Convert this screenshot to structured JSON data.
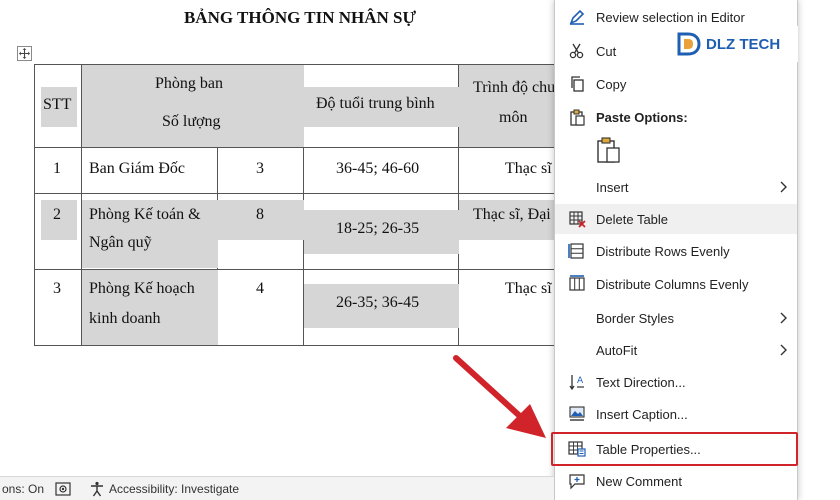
{
  "document": {
    "title": "BẢNG THÔNG TIN NHÂN SỰ",
    "table": {
      "headers": {
        "stt": "STT",
        "department": "Phòng ban",
        "quantity": "Số lượng",
        "age": "Độ tuổi trung bình",
        "education_line1": "Trình độ chu",
        "education_line2": "môn"
      },
      "rows": [
        {
          "stt": "1",
          "dept_line1": "Ban Giám Đốc",
          "dept_line2": "",
          "qty": "3",
          "age": "36-45; 46-60",
          "edu": "Thạc sĩ"
        },
        {
          "stt": "2",
          "dept_line1": "Phòng Kế toán &",
          "dept_line2": "Ngân quỹ",
          "qty": "8",
          "age": "18-25; 26-35",
          "edu": "Thạc sĩ, Đại"
        },
        {
          "stt": "3",
          "dept_line1": "Phòng Kế hoạch",
          "dept_line2": "kinh doanh",
          "qty": "4",
          "age": "26-35; 36-45",
          "edu": "Thạc sĩ"
        }
      ]
    }
  },
  "context_menu": {
    "items": [
      {
        "label": "Review selection in Editor",
        "icon": "editor-pen-icon"
      },
      {
        "label": "Cut",
        "icon": "scissors-icon"
      },
      {
        "label": "Copy",
        "icon": "copy-icon"
      },
      {
        "label": "Paste Options:",
        "icon": "clipboard-icon"
      },
      {
        "label": "Insert",
        "icon": "none"
      },
      {
        "label": "Delete Table",
        "icon": "delete-table-icon"
      },
      {
        "label": "Distribute Rows Evenly",
        "icon": "distribute-rows-icon"
      },
      {
        "label": "Distribute Columns Evenly",
        "icon": "distribute-columns-icon"
      },
      {
        "label": "Border Styles",
        "icon": "none"
      },
      {
        "label": "AutoFit",
        "icon": "none"
      },
      {
        "label": "Text Direction...",
        "icon": "text-direction-icon"
      },
      {
        "label": "Insert Caption...",
        "icon": "insert-caption-icon"
      },
      {
        "label": "Table Properties...",
        "icon": "table-properties-icon"
      },
      {
        "label": "New Comment",
        "icon": "new-comment-icon"
      }
    ]
  },
  "watermark": {
    "text": "DLZ TECH"
  },
  "status_bar": {
    "left_text": "ons: On",
    "accessibility": "Accessibility: Investigate"
  },
  "colors": {
    "highlight_red": "#d0242a",
    "cell_shade": "#d6d6d6",
    "icon_blue": "#1f5fb3",
    "watermark_blue": "#1f5fb3"
  }
}
